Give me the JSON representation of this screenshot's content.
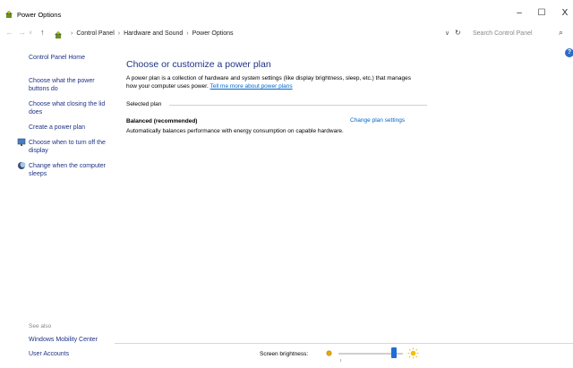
{
  "window": {
    "title": "Power Options",
    "minimize": "–",
    "maximize": "☐",
    "close": "X"
  },
  "address": {
    "back": "←",
    "forward": "→",
    "recent": "∨",
    "up": "↑",
    "crumbs": [
      "Control Panel",
      "Hardware and Sound",
      "Power Options"
    ],
    "separator": "›",
    "dropdown": "∨",
    "refresh": "↻",
    "search_placeholder": "Search Control Panel",
    "search_icon": "⌕"
  },
  "sidebar": {
    "home": "Control Panel Home",
    "items": [
      "Choose what the power buttons do",
      "Choose what closing the lid does",
      "Create a power plan",
      "Choose when to turn off the display",
      "Change when the computer sleeps"
    ],
    "see_also_label": "See also",
    "see_also": [
      "Windows Mobility Center",
      "User Accounts"
    ]
  },
  "main": {
    "heading": "Choose or customize a power plan",
    "description": "A power plan is a collection of hardware and system settings (like display brightness, sleep, etc.) that manages how your computer uses power.",
    "learn_more": "Tell me more about power plans",
    "selected_plan_label": "Selected plan",
    "plan_name": "Balanced (recommended)",
    "plan_change_link": "Change plan settings",
    "plan_description": "Automatically balances performance with energy consumption on capable hardware."
  },
  "help": {
    "glyph": "?"
  },
  "status": {
    "brightness_label": "Screen brightness:",
    "brightness_level": 0.9
  },
  "icons": {
    "app": "power-options-icon",
    "crumb": "control-panel-icon",
    "display": "monitor-shield-icon",
    "sleep": "moon-shield-icon",
    "dim": "dim-sun-icon",
    "bright": "bright-sun-icon"
  },
  "colors": {
    "link": "#1e3287",
    "hyperlink": "#0066cc",
    "accent": "#1f6ed6"
  }
}
